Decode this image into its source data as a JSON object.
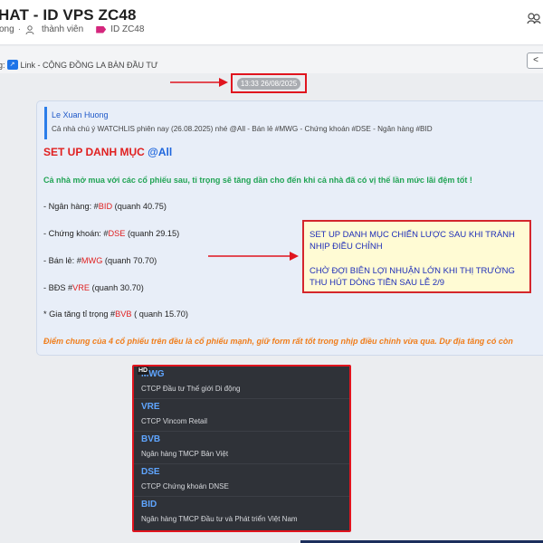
{
  "header": {
    "title": "HAT - ID VPS ZC48",
    "meta_left": "ong",
    "members_label": "thành viên",
    "tag_label": "ID ZC48"
  },
  "pinned": {
    "prefix": "g:",
    "link_text": "Link - CỘNG ĐỒNG LA BÀN ĐẦU TƯ",
    "corner_button": "<"
  },
  "timestamp": "13:33 26/08/2025",
  "message": {
    "quote_author": "Le Xuan Huong",
    "quote_preview": "Cả nhà chú ý WATCHLIS phiên nay (26.08.2025) nhé @All - Bán lẻ #MWG - Chứng khoán #DSE - Ngân hàng #BID",
    "heading": "SET UP DANH MỤC",
    "mention": "@All",
    "intro": "Cả nhà mở mua với các cổ phiếu sau, tỉ trọng sẽ tăng dần cho đến khi cả nhà đã có vị thế lần mức lãi đệm tốt !",
    "lines": [
      {
        "prefix": "- Ngân hàng: #",
        "code": "BID",
        "suffix": " (quanh 40.75)"
      },
      {
        "prefix": "- Chứng khoán: #",
        "code": "DSE",
        "suffix": " (quanh 29.15)"
      },
      {
        "prefix": "- Bán lẻ: #",
        "code": "MWG",
        "suffix": " (quanh 70.70)"
      },
      {
        "prefix": "- BĐS #",
        "code": "VRE",
        "suffix": " (quanh 30.70)"
      },
      {
        "prefix": "* Gia tăng tỉ trọng #",
        "code": "BVB",
        "suffix": " ( quanh 15.70)"
      }
    ],
    "footer": "Điểm chung của 4 cổ phiếu trên đều là cổ phiếu mạnh, giữ form rất tốt trong nhịp điều chỉnh vừa qua. Dự địa tăng có còn"
  },
  "note": {
    "para1": "SET UP DANH MỤC CHIẾN LƯỢC SAU KHI TRÁNH NHỊP ĐIỀU CHỈNH",
    "para2": "CHỜ ĐỢI BIÊN LỢI NHUẬN LỚN KHI THỊ TRƯỜNG THU HÚT DÒNG TIỀN SAU LỄ 2/9"
  },
  "stock_list": {
    "badge": "HD",
    "items": [
      {
        "code": "MWG",
        "name": "CTCP Đầu tư Thế giới Di động"
      },
      {
        "code": "VRE",
        "name": "CTCP Vincom Retail"
      },
      {
        "code": "BVB",
        "name": "Ngân hàng TMCP Bản Việt"
      },
      {
        "code": "DSE",
        "name": "CTCP Chứng khoán DNSE"
      },
      {
        "code": "BID",
        "name": "Ngân hàng TMCP Đầu tư và Phát triển Việt Nam"
      }
    ]
  },
  "colors": {
    "accent_red": "#e0141e",
    "mention_blue": "#1e66dd",
    "green_text": "#22a455",
    "orange_text": "#f07d1a",
    "note_text": "#1f2fb8",
    "stock_code": "#5fa5ff"
  },
  "icons": [
    "person-icon",
    "tag-icon",
    "link-icon",
    "chevron-left-icon",
    "emoji-group-icon",
    "arrow-icon"
  ]
}
